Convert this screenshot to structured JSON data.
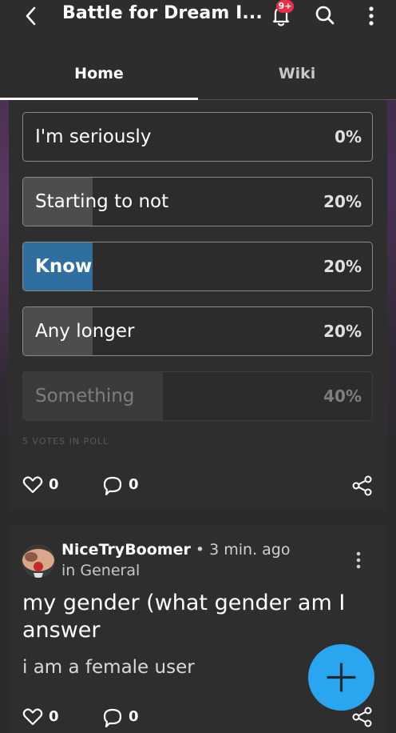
{
  "header": {
    "title": "Battle for Dream I...",
    "notification_badge": "9+",
    "icons": [
      "back-arrow-icon",
      "bell-icon",
      "search-icon",
      "more-vertical-icon"
    ]
  },
  "tabs": [
    {
      "label": "Home",
      "active": true
    },
    {
      "label": "Wiki",
      "active": false
    }
  ],
  "poll": {
    "options": [
      {
        "label": "I'm seriously",
        "percent_text": "0%",
        "percent": 0,
        "selected": false
      },
      {
        "label": "Starting to not",
        "percent_text": "20%",
        "percent": 20,
        "selected": false
      },
      {
        "label": "Know",
        "percent_text": "20%",
        "percent": 20,
        "selected": true
      },
      {
        "label": "Any longer",
        "percent_text": "20%",
        "percent": 20,
        "selected": false
      },
      {
        "label": "Something",
        "percent_text": "40%",
        "percent": 40,
        "selected": false
      }
    ],
    "votes_text": "5 VOTES IN POLL",
    "likes": "0",
    "comments": "0"
  },
  "post": {
    "author": "NiceTryBoomer",
    "time": " • 3 min. ago",
    "location": "in General",
    "title": "my gender (what gender am I answer",
    "body": "i am a female user",
    "likes": "0",
    "comments": "0"
  },
  "colors": {
    "accent_blue": "#2aa6f0",
    "selected_fill": "#2f6fa0",
    "badge_red": "#e8304a"
  }
}
